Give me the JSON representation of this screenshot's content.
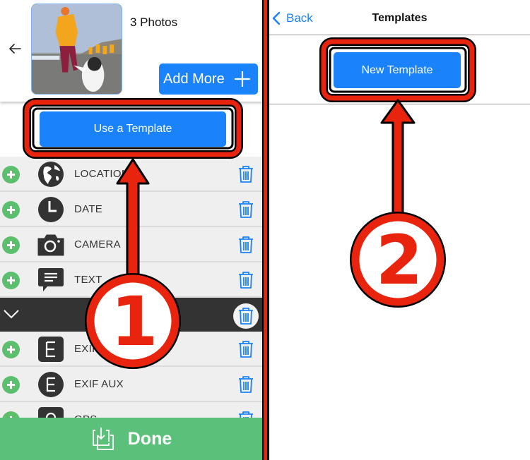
{
  "left_panel": {
    "photo_count": "3 Photos",
    "add_more_label": "Add More",
    "use_template_label": "Use a Template",
    "rows": [
      {
        "label": "LOCATION",
        "icon": "globe-icon"
      },
      {
        "label": "DATE",
        "icon": "clock-icon"
      },
      {
        "label": "CAMERA",
        "icon": "camera-icon"
      },
      {
        "label": "TEXT",
        "icon": "speech-bubble-icon"
      }
    ],
    "group_rows": [
      {
        "label": "EXIF",
        "icon": "exif-square-icon"
      },
      {
        "label": "EXIF AUX",
        "icon": "exif-circle-icon"
      },
      {
        "label": "GPS",
        "icon": "gps-icon"
      }
    ],
    "done_label": "Done"
  },
  "right_panel": {
    "back_label": "Back",
    "title": "Templates",
    "new_template_label": "New Template"
  },
  "annotations": {
    "step1": "1",
    "step2": "2"
  },
  "colors": {
    "accent_blue": "#1a82fb",
    "done_green": "#5bc17a",
    "add_green": "#5bbf6e",
    "annotation_red": "#e8240f"
  }
}
